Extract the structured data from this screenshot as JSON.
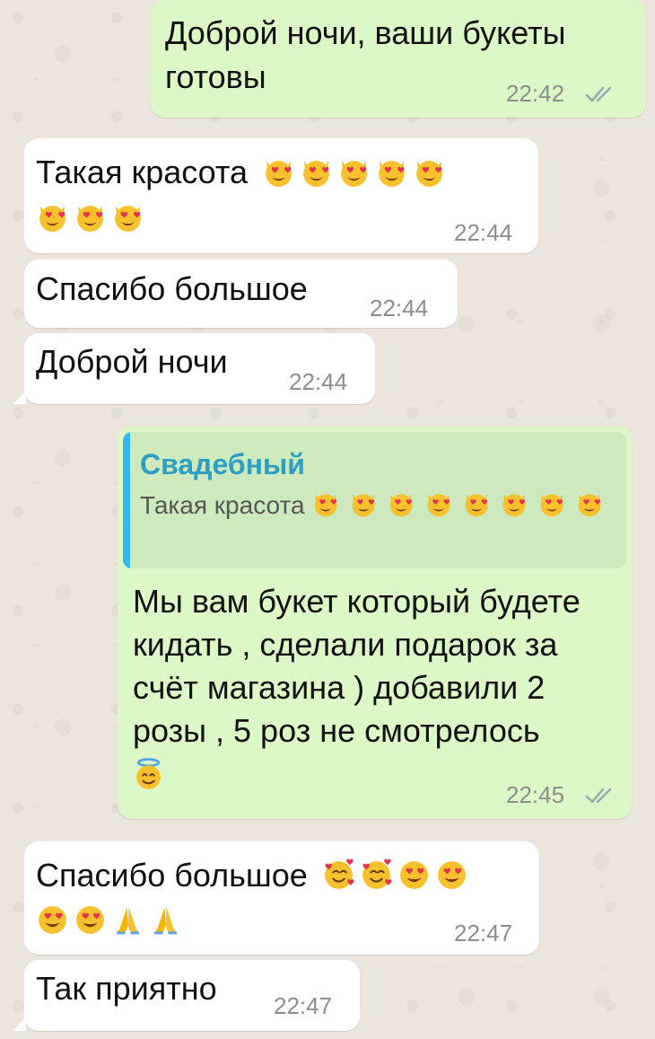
{
  "messages": [
    {
      "id": "m1",
      "direction": "outgoing",
      "text": "Доброй ночи, ваши букеты готовы",
      "time": "22:42",
      "status": "read"
    },
    {
      "id": "m2",
      "direction": "incoming",
      "text": "Такая красота",
      "emoji": [
        "heart-eyes-cat",
        "heart-eyes-cat",
        "heart-eyes-cat",
        "heart-eyes-cat",
        "heart-eyes-cat",
        "heart-eyes-cat",
        "heart-eyes-cat",
        "heart-eyes-cat"
      ],
      "time": "22:44"
    },
    {
      "id": "m3",
      "direction": "incoming",
      "text": "Спасибо большое",
      "time": "22:44"
    },
    {
      "id": "m4",
      "direction": "incoming",
      "text": "Доброй ночи",
      "time": "22:44"
    },
    {
      "id": "m5",
      "direction": "outgoing",
      "quote": {
        "author": "Свадебный",
        "text": "Такая красота",
        "emoji": [
          "heart-eyes-cat",
          "heart-eyes-cat",
          "heart-eyes-cat",
          "heart-eyes-cat",
          "heart-eyes-cat",
          "heart-eyes-cat",
          "heart-eyes-cat",
          "heart-eyes-cat"
        ]
      },
      "text": "Мы вам букет который будете кидать , сделали подарок за счёт магазина ) добавили 2 розы , 5 роз не смотрелось",
      "emoji": [
        "smiling-face-with-halo"
      ],
      "time": "22:45",
      "status": "read"
    },
    {
      "id": "m6",
      "direction": "incoming",
      "text": "Спасибо большое",
      "emoji": [
        "smiling-face-with-hearts",
        "smiling-face-with-hearts",
        "heart-eyes",
        "heart-eyes",
        "heart-eyes",
        "heart-eyes",
        "folded-hands",
        "folded-hands"
      ],
      "time": "22:47"
    },
    {
      "id": "m7",
      "direction": "incoming",
      "text": "Так приятно",
      "time": "22:47"
    }
  ],
  "colors": {
    "incoming_bubble": "#ffffff",
    "outgoing_bubble": "#dcf8c6",
    "quote_bar": "#34b7f1",
    "quote_author": "#2c9fc2",
    "read_checks": "#9aa7b1"
  }
}
